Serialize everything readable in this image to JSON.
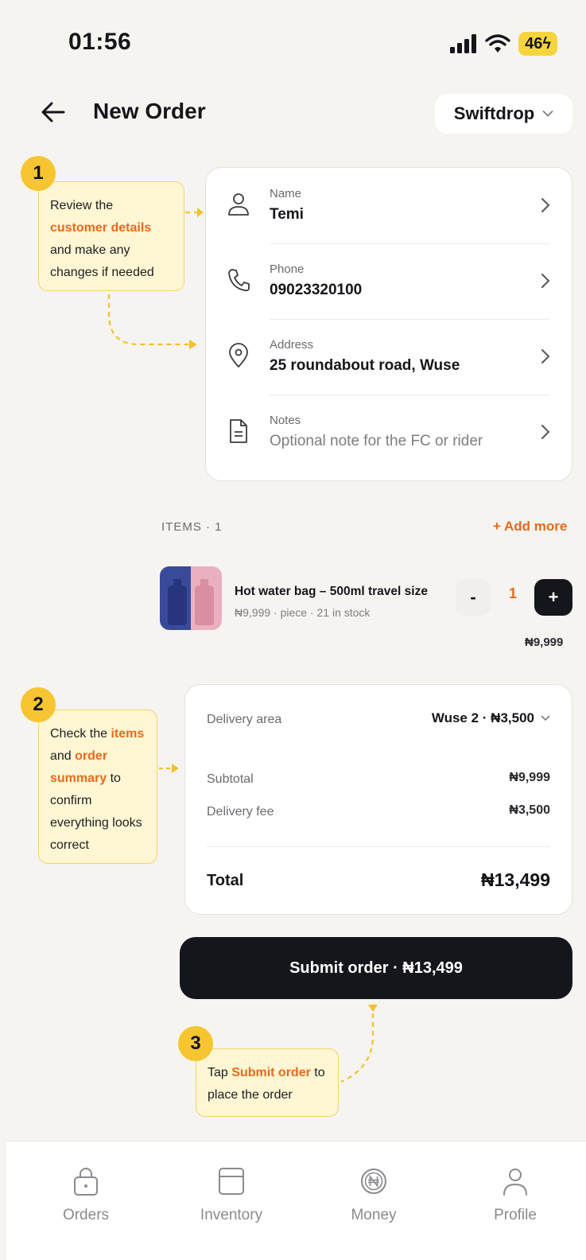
{
  "status_bar": {
    "time": "01:56",
    "battery": "46"
  },
  "header": {
    "title": "New Order",
    "selector": "Swiftdrop"
  },
  "customer": {
    "name_label": "Name",
    "name_value": "Temi",
    "phone_label": "Phone",
    "phone_value": "09023320100",
    "address_label": "Address",
    "address_value": "25 roundabout road, Wuse",
    "notes_label": "Notes",
    "notes_placeholder": "Optional note for the FC or rider"
  },
  "callouts": {
    "one": {
      "num": "1",
      "pre": "Review the ",
      "hl": "customer details",
      "post": " and make any changes if needed"
    },
    "two": {
      "num": "2",
      "pre": "Check the ",
      "hl1": "items",
      "mid": " and ",
      "hl2": "order summary",
      "post": " to confirm everything looks correct"
    },
    "three": {
      "num": "3",
      "pre": "Tap ",
      "hl": "Submit order",
      "post": " to place the order"
    }
  },
  "items": {
    "label": "ITEMS · 1",
    "add_more": "+ Add more",
    "list": [
      {
        "name": "Hot water bag – 500ml travel size",
        "meta": "₦9,999 · piece · 21 in stock",
        "qty": "1",
        "line_total": "₦9,999",
        "minus": "-",
        "plus": "+"
      }
    ]
  },
  "summary": {
    "delivery_area_label": "Delivery area",
    "delivery_area_value": "Wuse 2 · ₦3,500",
    "subtotal_label": "Subtotal",
    "subtotal_value": "₦9,999",
    "fee_label": "Delivery fee",
    "fee_value": "₦3,500",
    "total_label": "Total",
    "total_value": "₦13,499"
  },
  "submit_label": "Submit order · ₦13,499",
  "nav": [
    {
      "label": "Orders",
      "icon": "lock-bag-icon"
    },
    {
      "label": "Inventory",
      "icon": "box-icon"
    },
    {
      "label": "Money",
      "icon": "naira-coin-icon"
    },
    {
      "label": "Profile",
      "icon": "person-icon"
    }
  ],
  "colors": {
    "accent": "#e86a1c",
    "callout_bg": "#fff6d3",
    "badge": "#f6c531",
    "dark": "#15161b"
  }
}
